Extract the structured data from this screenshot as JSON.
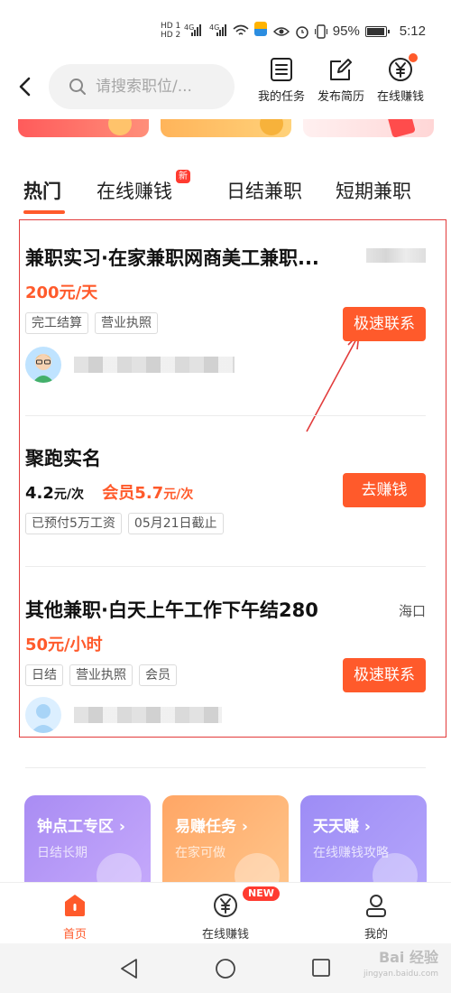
{
  "status_bar": {
    "network_top": "HD 1",
    "network_bottom": "HD 2",
    "signal_a": "4G",
    "signal_b": "4G",
    "battery": "95%",
    "time": "5:12"
  },
  "header": {
    "search_placeholder": "请搜索职位/...",
    "actions": [
      {
        "label": "我的任务",
        "icon": "task-list-icon"
      },
      {
        "label": "发布简历",
        "icon": "edit-resume-icon"
      },
      {
        "label": "在线赚钱",
        "icon": "yuan-coin-icon",
        "has_dot": true
      }
    ]
  },
  "tabs": {
    "items": [
      "热门",
      "在线赚钱",
      "日结兼职",
      "短期兼职"
    ],
    "active": "热门",
    "new_badge": "新"
  },
  "jobs": [
    {
      "title": "兼职实习·在家兼职网商美工兼职...",
      "price": "200元/天",
      "tags": [
        "完工结算",
        "营业执照"
      ],
      "button": "极速联系"
    },
    {
      "title": "聚跑实名",
      "price_value": "4.2",
      "price_unit": "元/次",
      "member_label": "会员",
      "member_value": "5.7",
      "member_unit": "元/次",
      "tags": [
        "已预付5万工资",
        "05月21日截止"
      ],
      "button": "去赚钱"
    },
    {
      "title": "其他兼职·白天上午工作下午结280",
      "location": "海口",
      "price": "50元/小时",
      "tags": [
        "日结",
        "营业执照",
        "会员"
      ],
      "button": "极速联系"
    }
  ],
  "features": [
    {
      "title": "钟点工专区",
      "arrow": "›",
      "subtitle": "日结长期",
      "color": "#a98cf3"
    },
    {
      "title": "易赚任务",
      "arrow": "›",
      "subtitle": "在家可做",
      "color": "#ffa665"
    },
    {
      "title": "天天赚",
      "arrow": "›",
      "subtitle": "在线赚钱攻略",
      "color": "#9d8cf5"
    }
  ],
  "bottom_nav": {
    "items": [
      {
        "label": "首页",
        "icon": "home-icon",
        "active": true
      },
      {
        "label": "在线赚钱",
        "icon": "yuan-coin-icon",
        "active": false
      },
      {
        "label": "我的",
        "icon": "profile-icon",
        "active": false
      }
    ],
    "new_badge": "NEW"
  },
  "watermark": {
    "text": "Bai 经验",
    "sub": "jingyan.baidu.com"
  },
  "colors": {
    "accent": "#ff5a2b",
    "highlight_border": "#e23b3b",
    "badge": "#ff3b30"
  }
}
